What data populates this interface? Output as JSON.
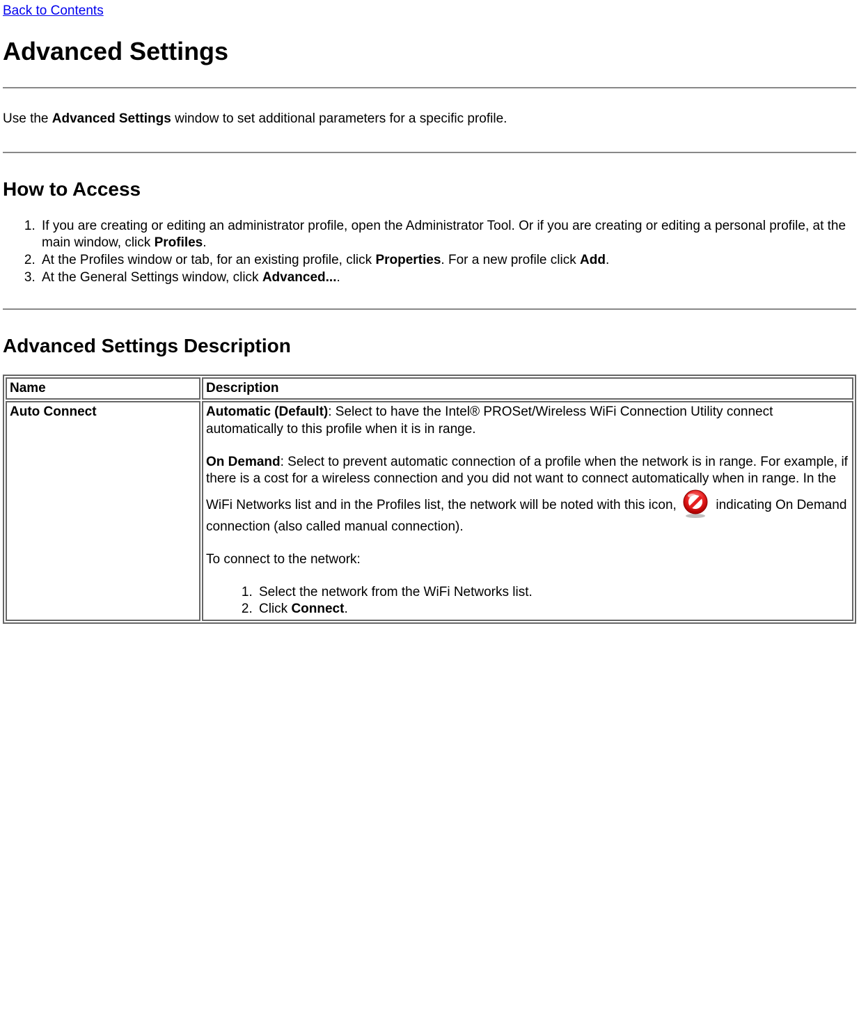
{
  "topLink": "Back to Contents",
  "h1": "Advanced Settings",
  "intro_pre": "Use the ",
  "intro_bold": "Advanced Settings",
  "intro_post": " window to set additional parameters for a specific profile.",
  "h2_access": "How to Access",
  "steps": {
    "s1_pre": "If you are creating or editing an administrator profile, open the Administrator Tool. Or if you are creating or editing a personal profile, at the main window, click ",
    "s1_b": "Profiles",
    "s1_post": ".",
    "s2_pre": "At the Profiles window or tab, for an existing profile, click ",
    "s2_b1": "Properties",
    "s2_mid": ". For a new profile click ",
    "s2_b2": "Add",
    "s2_post": ".",
    "s3_pre": "At the General Settings window, click ",
    "s3_b": "Advanced...",
    "s3_post": "."
  },
  "h2_desc": "Advanced Settings Description",
  "table": {
    "header_name": "Name",
    "header_desc": "Description",
    "row1_name": "Auto Connect",
    "auto_b": "Automatic (Default)",
    "auto_post": ": Select to have the Intel® PROSet/Wireless WiFi Connection Utility connect automatically to this profile when it is in range.",
    "ondemand_b": "On Demand",
    "ondemand_post1": ": Select to prevent automatic connection of a profile when the network is in range. For example, if there is a cost for a wireless connection and you did not want to connect automatically when in range. In the WiFi Networks list and in the Profiles list, the network will be noted with this icon, ",
    "ondemand_post2": " indicating On Demand connection (also called manual connection).",
    "toconnect": "To connect to the network:",
    "inner1": "Select the network from the WiFi Networks list.",
    "inner2_pre": "Click ",
    "inner2_b": "Connect",
    "inner2_post": "."
  }
}
